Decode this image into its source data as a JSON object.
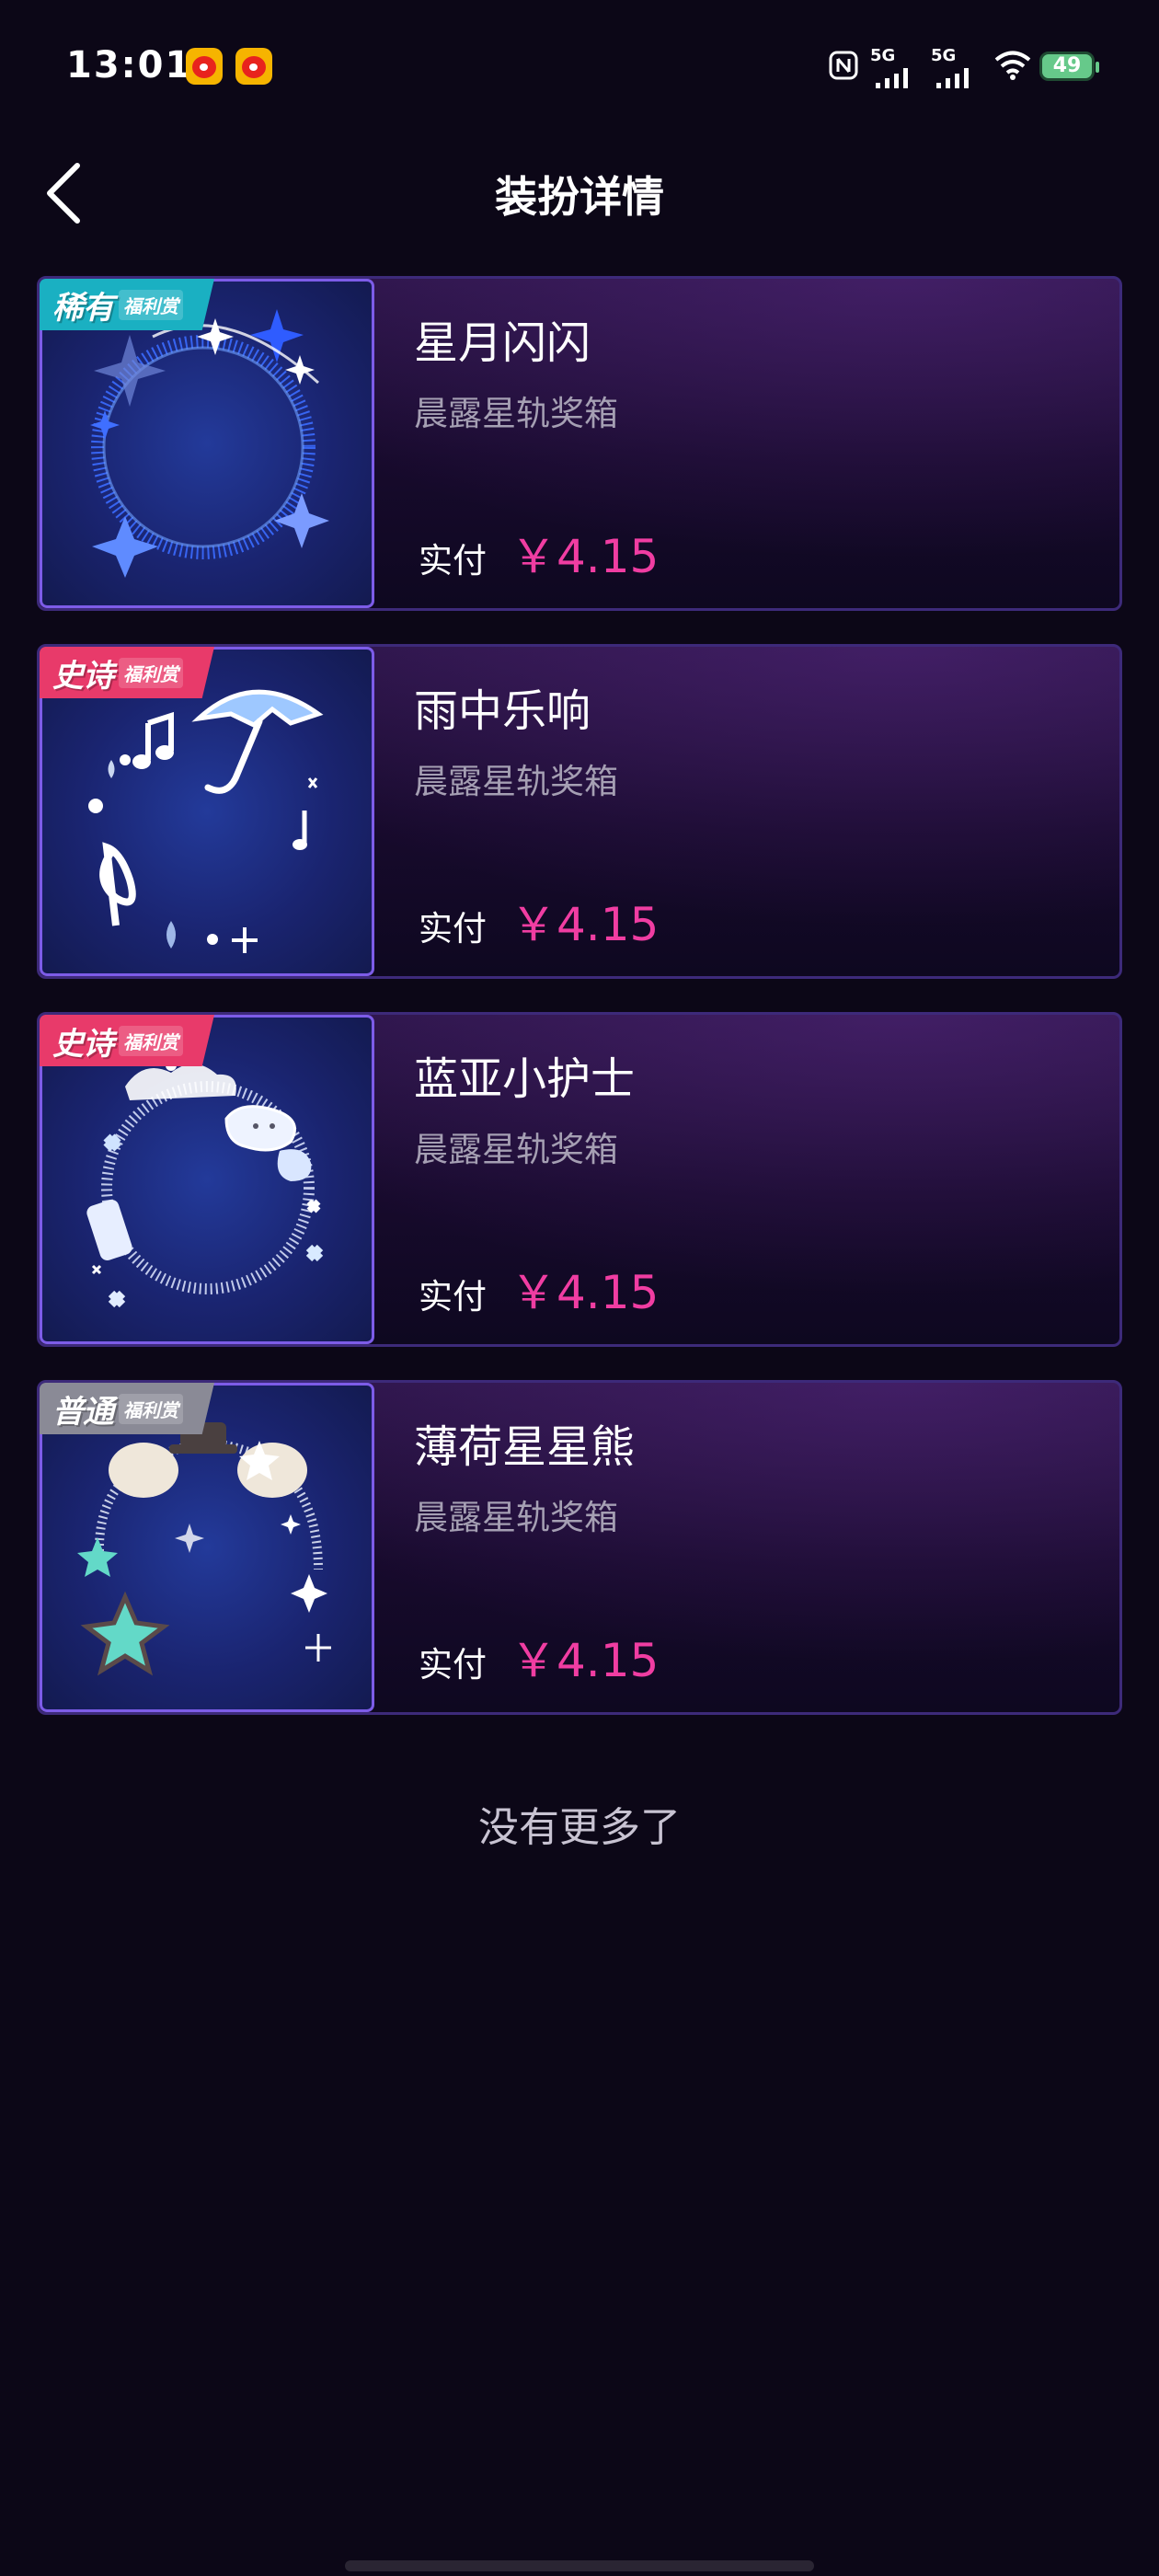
{
  "status_bar": {
    "time": "13:01",
    "network_1": "5G",
    "network_2": "5G",
    "battery": "49",
    "icons": [
      "weibo-icon",
      "weibo-icon",
      "nfc-icon",
      "signal-icon",
      "signal-icon",
      "wifi-icon",
      "battery-icon"
    ]
  },
  "header": {
    "title": "装扮详情",
    "back_icon": "chevron-left-icon"
  },
  "items": [
    {
      "badge_main": "稀有",
      "badge_sub": "福利赏",
      "badge_color": "#1ab0c2",
      "name": "星月闪闪",
      "source": "晨露星轨奖箱",
      "price_label": "实付",
      "price": "￥4.15",
      "art": "blue-star-ring"
    },
    {
      "badge_main": "史诗",
      "badge_sub": "福利赏",
      "badge_color": "#e83a6a",
      "name": "雨中乐响",
      "source": "晨露星轨奖箱",
      "price_label": "实付",
      "price": "￥4.15",
      "art": "umbrella-music-ring"
    },
    {
      "badge_main": "史诗",
      "badge_sub": "福利赏",
      "badge_color": "#e83a6a",
      "name": "蓝亚小护士",
      "source": "晨露星轨奖箱",
      "price_label": "实付",
      "price": "￥4.15",
      "art": "nurse-cloud-ring"
    },
    {
      "badge_main": "普通",
      "badge_sub": "福利赏",
      "badge_color": "#8a8a96",
      "name": "薄荷星星熊",
      "source": "晨露星轨奖箱",
      "price_label": "实付",
      "price": "￥4.15",
      "art": "mint-star-bear-ring"
    }
  ],
  "end_text": "没有更多了",
  "colors": {
    "background": "#0c0717",
    "price": "#f03da2",
    "card_border": "#3d2a7a",
    "thumb_border": "#7d5ce8"
  }
}
